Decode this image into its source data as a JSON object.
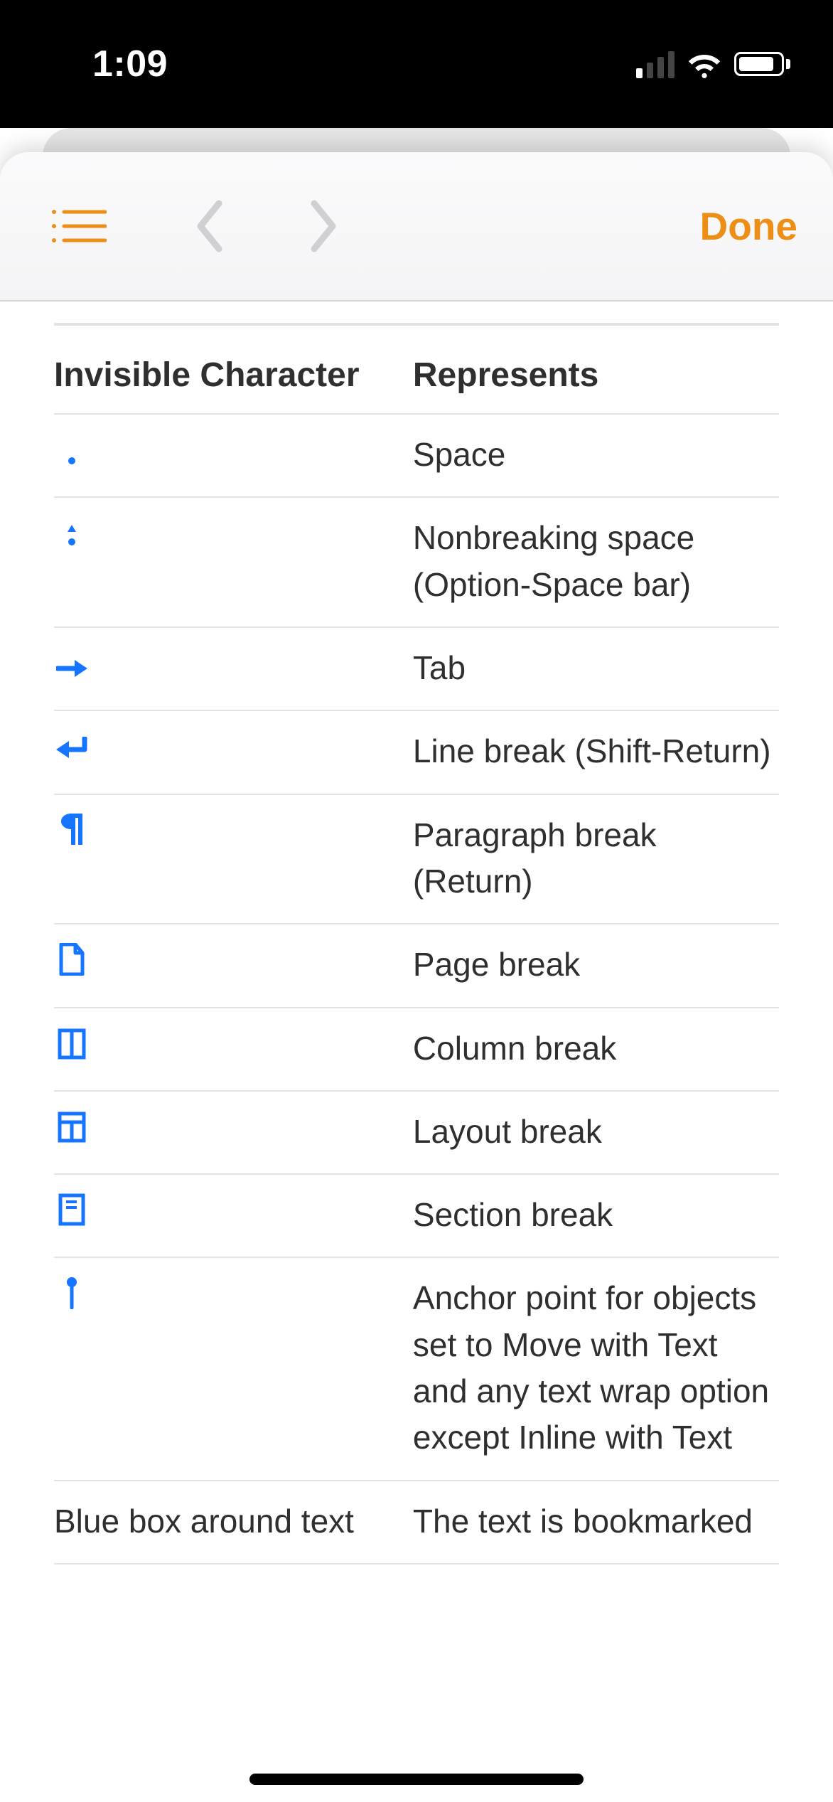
{
  "status": {
    "time": "1:09"
  },
  "navbar": {
    "done_label": "Done"
  },
  "table": {
    "header": {
      "col1": "Invisible Character",
      "col2": "Represents"
    },
    "rows": [
      {
        "icon": "space-dot-icon",
        "represents": "Space"
      },
      {
        "icon": "nbsp-icon",
        "represents": "Nonbreaking space (Option-Space bar)"
      },
      {
        "icon": "tab-arrow-icon",
        "represents": "Tab"
      },
      {
        "icon": "line-break-icon",
        "represents": "Line break (Shift-Return)"
      },
      {
        "icon": "pilcrow-icon",
        "represents": "Paragraph break (Return)"
      },
      {
        "icon": "page-break-icon",
        "represents": "Page break"
      },
      {
        "icon": "column-break-icon",
        "represents": "Column break"
      },
      {
        "icon": "layout-break-icon",
        "represents": "Layout break"
      },
      {
        "icon": "section-break-icon",
        "represents": "Section break"
      },
      {
        "icon": "anchor-point-icon",
        "represents": "Anchor point for objects set to Move with Text and any text wrap option except Inline with Text"
      },
      {
        "text": "Blue box around text",
        "represents": "The text is bookmarked"
      }
    ]
  }
}
